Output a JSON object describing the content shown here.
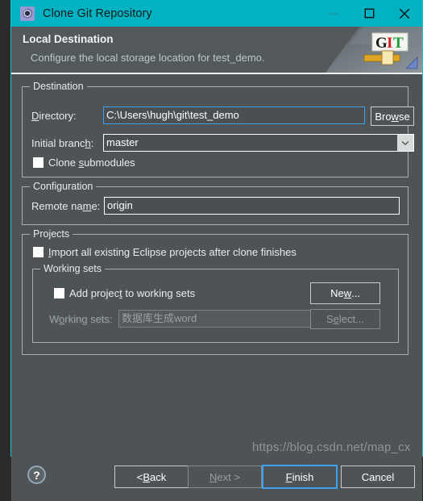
{
  "window": {
    "title": "Clone Git Repository",
    "icon": "git-repository-icon",
    "controls": {
      "minimize": "minimize-icon",
      "maximize": "maximize-icon",
      "close": "close-icon"
    },
    "accent_color": "#00b2c2",
    "surface_color": "#4e5456"
  },
  "header": {
    "title": "Local Destination",
    "subtitle": "Configure the local storage location for test_demo.",
    "logo": {
      "name": "git-logo",
      "letters": [
        "G",
        "I",
        "T"
      ],
      "letter_colors": [
        "#1a1a1a",
        "#cf2020",
        "#1f9c3a"
      ]
    }
  },
  "destination": {
    "legend": "Destination",
    "directory": {
      "label": "Directory:",
      "mnemonic": "D",
      "value": "C:\\Users\\hugh\\git\\test_demo",
      "focused": true
    },
    "browse_button": {
      "label": "Browse",
      "mnemonic": "w"
    },
    "initial_branch": {
      "label": "Initial branch:",
      "mnemonic": "h",
      "value": "master",
      "options": [
        "master"
      ]
    },
    "clone_submodules": {
      "label": "Clone submodules",
      "mnemonic": "s",
      "checked": false
    }
  },
  "configuration": {
    "legend": "Configuration",
    "remote_name": {
      "label": "Remote name:",
      "mnemonic": "m",
      "value": "origin"
    }
  },
  "projects": {
    "legend": "Projects",
    "import_all": {
      "label": "Import all existing Eclipse projects after clone finishes",
      "mnemonic": "I",
      "checked": false
    },
    "working_sets": {
      "legend": "Working sets",
      "add_project": {
        "label": "Add project to working sets",
        "mnemonic": "t",
        "checked": false
      },
      "sets_label": "Working sets:",
      "sets_mnemonic": "o",
      "sets_value": "数据库生成word",
      "sets_enabled": false,
      "new_button": {
        "label": "New...",
        "mnemonic": "w",
        "enabled": true
      },
      "select_button": {
        "label": "Select...",
        "mnemonic": "e",
        "enabled": false
      }
    }
  },
  "footer": {
    "help": "help-icon",
    "buttons": [
      {
        "label": "< Back",
        "name": "back-button",
        "enabled": true,
        "default": false
      },
      {
        "label": "Next >",
        "name": "next-button",
        "enabled": false,
        "default": false
      },
      {
        "label": "Finish",
        "name": "finish-button",
        "enabled": true,
        "default": true
      },
      {
        "label": "Cancel",
        "name": "cancel-button",
        "enabled": true,
        "default": false
      }
    ]
  },
  "watermark": "https://blog.csdn.net/map_cx"
}
